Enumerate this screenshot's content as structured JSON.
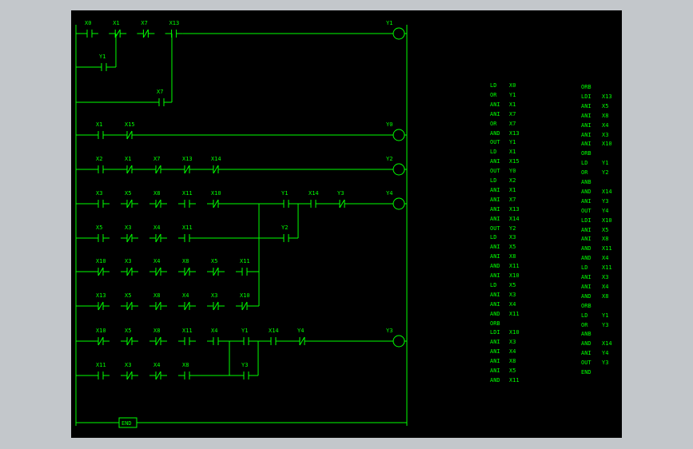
{
  "rungs": [
    {
      "branches": [
        [
          "X0",
          "/X1",
          "/X7",
          "X13"
        ],
        [
          "Y1"
        ],
        [
          "X7"
        ]
      ],
      "coil": "Y1"
    },
    {
      "branches": [
        [
          "X1",
          "/X15"
        ]
      ],
      "coil": "Y0"
    },
    {
      "branches": [
        [
          "X2",
          "/X1",
          "/X7",
          "/X13",
          "/X14"
        ]
      ],
      "coil": "Y2"
    },
    {
      "branches": [
        [
          "X3",
          "/X5",
          "/X8",
          "X11",
          "/X10",
          "Y1",
          "X14",
          "/Y3"
        ],
        [
          "X5",
          "/X3",
          "/X4",
          "X11",
          "Y2"
        ],
        [
          "/X10",
          "/X3",
          "/X4",
          "/X8",
          "/X5",
          "X11"
        ],
        [
          "/X13",
          "/X5",
          "/X8",
          "/X4",
          "/X3",
          "/X10"
        ]
      ],
      "coil": "Y4"
    },
    {
      "branches": [
        [
          "/X10",
          "/X5",
          "/X8",
          "X11",
          "X4",
          "Y1",
          "X14",
          "/Y4"
        ],
        [
          "X11",
          "/X3",
          "/X4",
          "X8",
          "Y3"
        ]
      ],
      "coil": "Y3"
    },
    {
      "end": "END"
    }
  ],
  "instructions": {
    "col1": [
      [
        "LD",
        "X0"
      ],
      [
        "OR",
        "Y1"
      ],
      [
        "ANI",
        "X1"
      ],
      [
        "ANI",
        "X7"
      ],
      [
        "OR",
        "X7"
      ],
      [
        "AND",
        "X13"
      ],
      [
        "OUT",
        "Y1"
      ],
      [
        "LD",
        "X1"
      ],
      [
        "ANI",
        "X15"
      ],
      [
        "OUT",
        "Y0"
      ],
      [
        "LD",
        "X2"
      ],
      [
        "ANI",
        "X1"
      ],
      [
        "ANI",
        "X7"
      ],
      [
        "ANI",
        "X13"
      ],
      [
        "ANI",
        "X14"
      ],
      [
        "OUT",
        "Y2"
      ],
      [
        "LD",
        "X3"
      ],
      [
        "ANI",
        "X5"
      ],
      [
        "ANI",
        "X8"
      ],
      [
        "AND",
        "X11"
      ],
      [
        "ANI",
        "X10"
      ],
      [
        "LD",
        "X5"
      ],
      [
        "ANI",
        "X3"
      ],
      [
        "ANI",
        "X4"
      ],
      [
        "AND",
        "X11"
      ],
      [
        "ORB",
        ""
      ],
      [
        "LDI",
        "X10"
      ],
      [
        "ANI",
        "X3"
      ],
      [
        "ANI",
        "X4"
      ],
      [
        "ANI",
        "X8"
      ],
      [
        "ANI",
        "X5"
      ],
      [
        "AND",
        "X11"
      ]
    ],
    "col2": [
      [
        "ORB",
        ""
      ],
      [
        "LDI",
        "X13"
      ],
      [
        "ANI",
        "X5"
      ],
      [
        "ANI",
        "X8"
      ],
      [
        "ANI",
        "X4"
      ],
      [
        "ANI",
        "X3"
      ],
      [
        "ANI",
        "X10"
      ],
      [
        "ORB",
        ""
      ],
      [
        "LD",
        "Y1"
      ],
      [
        "OR",
        "Y2"
      ],
      [
        "ANB",
        ""
      ],
      [
        "AND",
        "X14"
      ],
      [
        "ANI",
        "Y3"
      ],
      [
        "OUT",
        "Y4"
      ],
      [
        "LDI",
        "X10"
      ],
      [
        "ANI",
        "X5"
      ],
      [
        "ANI",
        "X8"
      ],
      [
        "AND",
        "X11"
      ],
      [
        "AND",
        "X4"
      ],
      [
        "LD",
        "X11"
      ],
      [
        "ANI",
        "X3"
      ],
      [
        "ANI",
        "X4"
      ],
      [
        "AND",
        "X8"
      ],
      [
        "ORB",
        ""
      ],
      [
        "LD",
        "Y1"
      ],
      [
        "OR",
        "Y3"
      ],
      [
        "ANB",
        ""
      ],
      [
        "AND",
        "X14"
      ],
      [
        "ANI",
        "Y4"
      ],
      [
        "OUT",
        "Y3"
      ],
      [
        "END",
        ""
      ]
    ]
  }
}
